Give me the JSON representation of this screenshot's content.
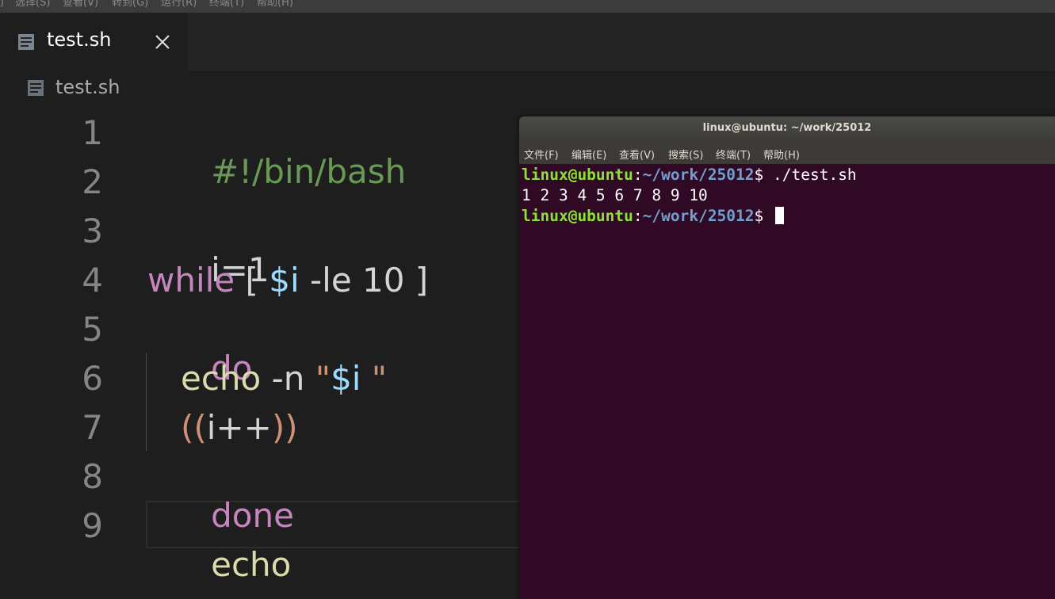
{
  "menubar": {
    "items": [
      ")",
      "选择(S)",
      "查看(V)",
      "转到(G)",
      "运行(R)",
      "终端(T)",
      "帮助(H)"
    ]
  },
  "tab": {
    "label": "test.sh",
    "close": "✕"
  },
  "breadcrumb": {
    "file": "test.sh"
  },
  "editor": {
    "line_numbers": [
      "1",
      "2",
      "3",
      "4",
      "5",
      "6",
      "7",
      "8",
      "9"
    ],
    "lines": {
      "l1": "#!/bin/bash",
      "l3": "i=1",
      "l4_kw": "while",
      "l4_open": " [ ",
      "l4_var": "$i",
      "l4_rest": " -le 10 ]",
      "l5": "do",
      "l6_fn": "echo",
      "l6_flag": " -n ",
      "l6_q1": "\"",
      "l6_var": "$i",
      "l6_q2": " \"",
      "l7_open": "((",
      "l7_mid": "i++",
      "l7_close": "))",
      "l8": "done",
      "l9": "echo"
    }
  },
  "terminal": {
    "title": "linux@ubuntu: ~/work/25012",
    "menu": [
      "文件(F)",
      "编辑(E)",
      "查看(V)",
      "搜索(S)",
      "终端(T)",
      "帮助(H)"
    ],
    "prompt_user": "linux@ubuntu",
    "prompt_colon": ":",
    "prompt_path": "~/work/25012",
    "prompt_dollar": "$ ",
    "command": "./test.sh",
    "output": "1 2 3 4 5 6 7 8 9 10"
  },
  "colors": {
    "editor_bg": "#1e1e1e",
    "comment": "#6a9955",
    "keyword": "#c586c0",
    "variable": "#9cdcfe",
    "function": "#dcdcaa",
    "string": "#ce9178",
    "terminal_bg": "#300a24",
    "prompt_user": "#8ae234",
    "prompt_path": "#729fcf"
  }
}
